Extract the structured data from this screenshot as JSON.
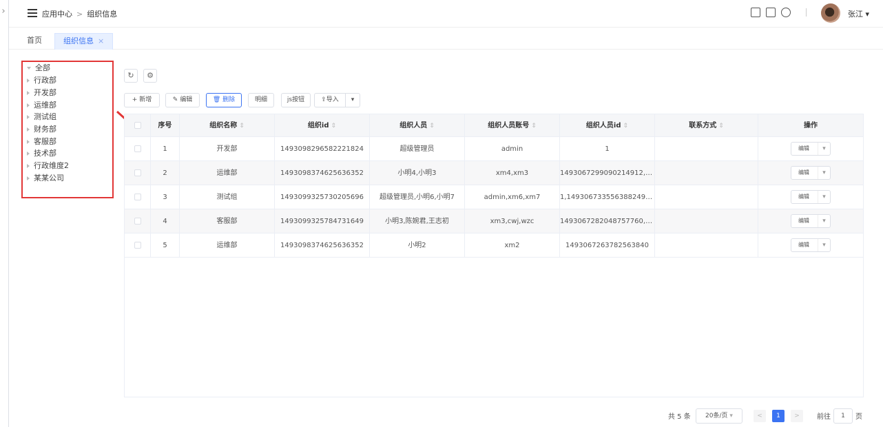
{
  "breadcrumb": {
    "root": "应用中心",
    "separator": ">",
    "current": "组织信息"
  },
  "user": {
    "name": "张江 ▾"
  },
  "tabs": [
    {
      "label": "首页"
    },
    {
      "label": "组织信息",
      "close": "×"
    }
  ],
  "tree": [
    "全部",
    "行政部",
    "开发部",
    "运维部",
    "测试组",
    "财务部",
    "客服部",
    "技术部",
    "行政维度2",
    "某某公司"
  ],
  "toolbar": {
    "add": "+ 新增",
    "edit": "✎ 编辑",
    "delete": "🗑 删除",
    "detail": "明细",
    "js": "js按钮",
    "import": "⇪导入",
    "import_more": "▾"
  },
  "columns": [
    "序号",
    "组织名称",
    "组织id",
    "组织人员",
    "组织人员账号",
    "组织人员id",
    "联系方式",
    "操作"
  ],
  "rows": [
    {
      "no": "1",
      "name": "开发部",
      "id": "1493098296582221824",
      "members": "超级管理员",
      "accounts": "admin",
      "member_ids": "1",
      "contact": "",
      "op": "编辑"
    },
    {
      "no": "2",
      "name": "运维部",
      "id": "1493098374625636352",
      "members": "小明4,小明3",
      "accounts": "xm4,xm3",
      "member_ids": "1493067299090214912,1...",
      "contact": "",
      "op": "编辑"
    },
    {
      "no": "3",
      "name": "测试组",
      "id": "1493099325730205696",
      "members": "超级管理员,小明6,小明7",
      "accounts": "admin,xm6,xm7",
      "member_ids": "1,1493067335563882496,...",
      "contact": "",
      "op": "编辑"
    },
    {
      "no": "4",
      "name": "客服部",
      "id": "1493099325784731649",
      "members": "小明3,陈婉君,王志初",
      "accounts": "xm3,cwj,wzc",
      "member_ids": "1493067282048757760,1...",
      "contact": "",
      "op": "编辑"
    },
    {
      "no": "5",
      "name": "运维部",
      "id": "1493098374625636352",
      "members": "小明2",
      "accounts": "xm2",
      "member_ids": "1493067263782563840",
      "contact": "",
      "op": "编辑"
    }
  ],
  "pagination": {
    "total": "共 5 条",
    "page_size": "20条/页",
    "prev": "<",
    "current": "1",
    "next": ">",
    "goto_label": "前往",
    "goto_value": "1",
    "page_suffix": "页"
  },
  "colors": {
    "accent": "#3b73f2",
    "highlight_border": "#e23636"
  }
}
